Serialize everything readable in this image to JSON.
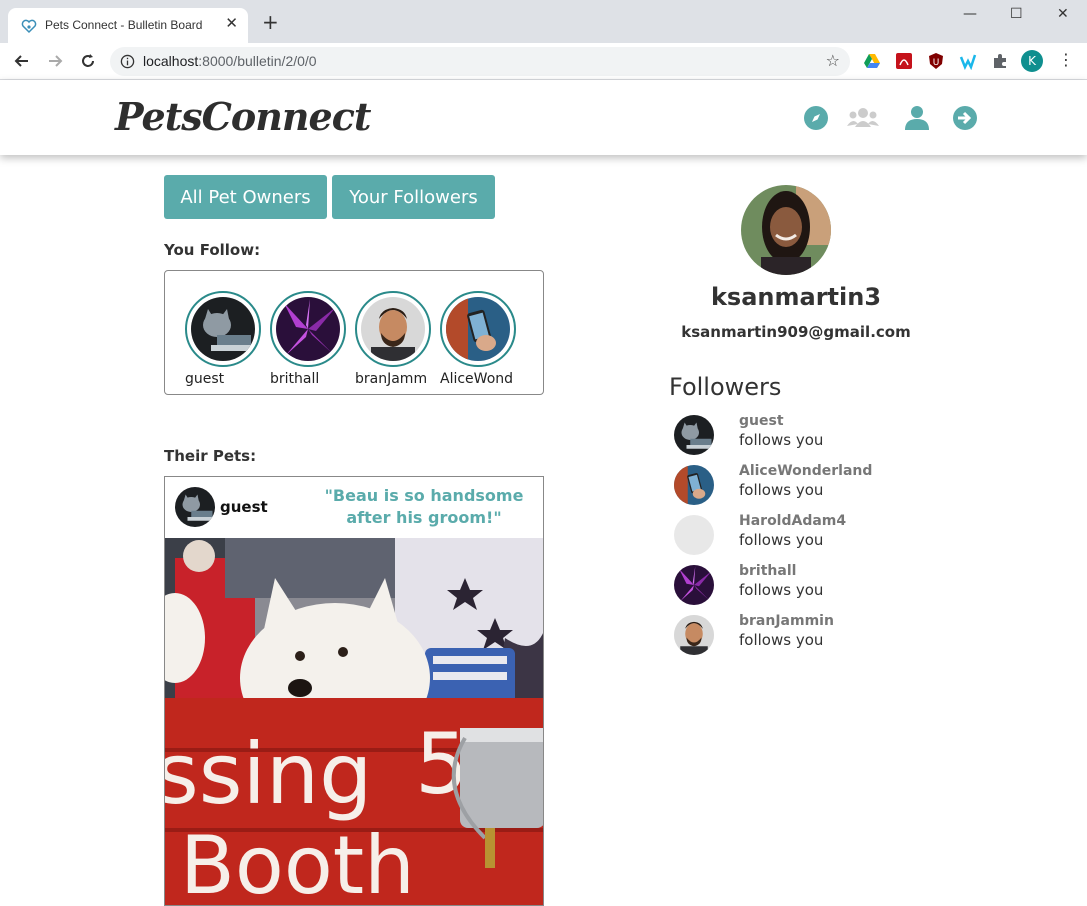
{
  "browser": {
    "tab_title": "Pets Connect - Bulletin Board",
    "url_host": "localhost",
    "url_path": ":8000/bulletin/2/0/0",
    "profile_initial": "K"
  },
  "site": {
    "logo_text": "PetsConnect",
    "accent_color": "#5aabab",
    "nav_icons": [
      "compass-icon",
      "group-icon",
      "user-icon",
      "logout-arrow-icon"
    ]
  },
  "main": {
    "tabs": [
      {
        "label": "All Pet Owners"
      },
      {
        "label": "Your Followers"
      }
    ],
    "you_follow_label": "You Follow:",
    "following": [
      {
        "name": "guest"
      },
      {
        "name": "brithall"
      },
      {
        "name": "branJamm"
      },
      {
        "name": "AliceWond"
      }
    ],
    "their_pets_label": "Their Pets:",
    "post": {
      "user": "guest",
      "caption": "\"Beau is so handsome after his groom!\""
    }
  },
  "profile": {
    "username": "ksanmartin3",
    "email": "ksanmartin909@gmail.com",
    "followers_title": "Followers",
    "followers": [
      {
        "name": "guest",
        "status": "follows you"
      },
      {
        "name": "AliceWonderland",
        "status": "follows you"
      },
      {
        "name": "HaroldAdam4",
        "status": "follows you"
      },
      {
        "name": "brithall",
        "status": "follows you"
      },
      {
        "name": "branJammin",
        "status": "follows you"
      }
    ]
  }
}
